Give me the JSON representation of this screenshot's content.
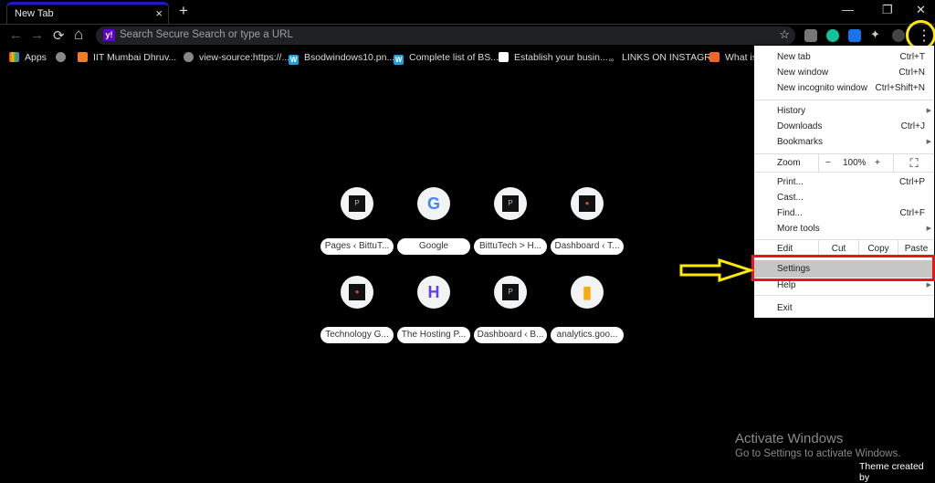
{
  "tab": {
    "title": "New Tab",
    "close": "×",
    "new_tab": "+"
  },
  "window": {
    "minimize": "—",
    "restore": "❐",
    "close": "✕"
  },
  "toolbar": {
    "back": "←",
    "forward": "→",
    "reload": "⟳",
    "home": "⌂",
    "search_placeholder": "Search Secure Search or type a URL",
    "search_logo": "y!",
    "star": "☆",
    "menu_button": "⋮"
  },
  "bookmarks": [
    {
      "label": "Apps",
      "icon": "apps-grid-icon"
    },
    {
      "label": "",
      "icon": "globe-icon"
    },
    {
      "label": "IIT Mumbai Dhruv...",
      "icon": "site-icon"
    },
    {
      "label": "view-source:https://...",
      "icon": "globe-icon"
    },
    {
      "label": "Bsodwindows10.pn...",
      "icon": "w-icon"
    },
    {
      "label": "Complete list of BS...",
      "icon": "w-icon"
    },
    {
      "label": "Establish your busin...",
      "icon": "google-business-icon"
    },
    {
      "label": "LINKS ON INSTAGR...",
      "icon": "link-icon"
    },
    {
      "label": "What is",
      "icon": "orange-site-icon"
    }
  ],
  "shortcuts": [
    {
      "label": "Pages ‹ BittuT...",
      "icon": "p-icon"
    },
    {
      "label": "Google",
      "icon": "google-icon"
    },
    {
      "label": "BittuTech > H...",
      "icon": "p-icon"
    },
    {
      "label": "Dashboard ‹ T...",
      "icon": "site-dark-icon"
    },
    {
      "label": "Technology G...",
      "icon": "site-dark-icon"
    },
    {
      "label": "The Hosting P...",
      "icon": "hostinger-icon"
    },
    {
      "label": "Dashboard ‹ B...",
      "icon": "p-icon"
    },
    {
      "label": "analytics.goo...",
      "icon": "analytics-icon"
    }
  ],
  "menu": {
    "new_tab": {
      "label": "New tab",
      "shortcut": "Ctrl+T"
    },
    "new_window": {
      "label": "New window",
      "shortcut": "Ctrl+N"
    },
    "incognito": {
      "label": "New incognito window",
      "shortcut": "Ctrl+Shift+N"
    },
    "history": {
      "label": "History"
    },
    "downloads": {
      "label": "Downloads",
      "shortcut": "Ctrl+J"
    },
    "bookmarks": {
      "label": "Bookmarks"
    },
    "zoom": {
      "label": "Zoom",
      "minus": "−",
      "value": "100%",
      "plus": "+",
      "fullscreen": "⛶"
    },
    "print": {
      "label": "Print...",
      "shortcut": "Ctrl+P"
    },
    "cast": {
      "label": "Cast..."
    },
    "find": {
      "label": "Find...",
      "shortcut": "Ctrl+F"
    },
    "more_tools": {
      "label": "More tools"
    },
    "edit": {
      "label": "Edit",
      "cut": "Cut",
      "copy": "Copy",
      "paste": "Paste"
    },
    "settings": {
      "label": "Settings"
    },
    "help": {
      "label": "Help"
    },
    "exit": {
      "label": "Exit"
    },
    "submenu_arrow": "▶"
  },
  "watermark": {
    "title": "Activate Windows",
    "subtitle": "Go to Settings to activate Windows."
  },
  "theme_credit": "Theme created by",
  "colors": {
    "annotation_yellow": "#ffea00",
    "annotation_red": "#e8141f",
    "tab_accent": "#1a1acc",
    "highlight": "#c6c6c6"
  }
}
